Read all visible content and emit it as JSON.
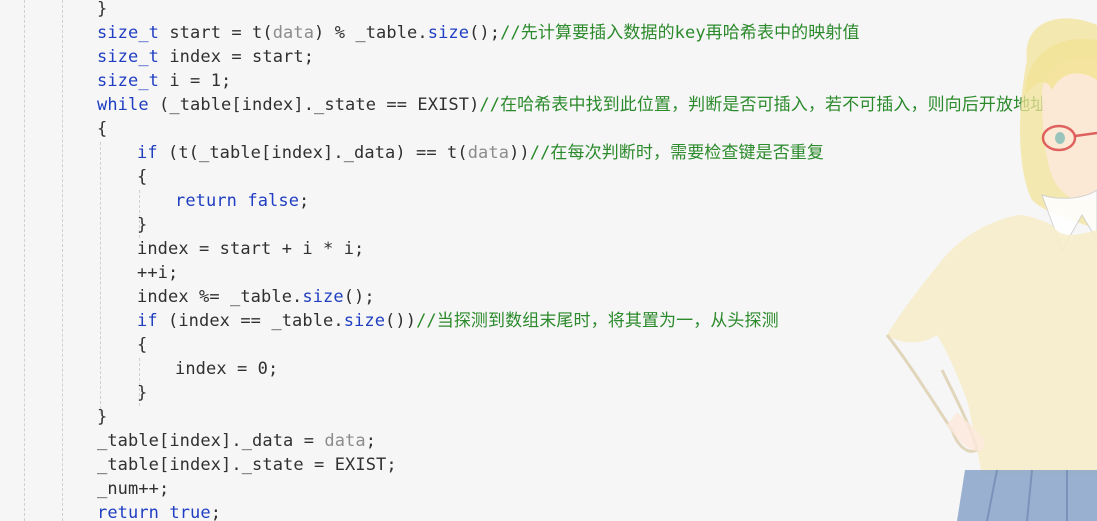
{
  "code": {
    "lines": [
      [
        {
          "t": "}",
          "c": "p"
        }
      ],
      [
        {
          "t": "size_t",
          "c": "k"
        },
        {
          "t": " start = t(",
          "c": "p"
        },
        {
          "t": "data",
          "c": "d"
        },
        {
          "t": ") % _table.",
          "c": "p"
        },
        {
          "t": "size",
          "c": "k"
        },
        {
          "t": "();",
          "c": "p"
        },
        {
          "t": "//先计算要插入数据的key再哈希表中的映射值",
          "c": "c"
        }
      ],
      [
        {
          "t": "size_t",
          "c": "k"
        },
        {
          "t": " index = start;",
          "c": "p"
        }
      ],
      [
        {
          "t": "size_t",
          "c": "k"
        },
        {
          "t": " i = 1;",
          "c": "p"
        }
      ],
      [
        {
          "t": "while",
          "c": "k"
        },
        {
          "t": " (_table[index]._state == EXIST)",
          "c": "p"
        },
        {
          "t": "//在哈希表中找到此位置，判断是否可插入，若不可插入，则向后开放地址",
          "c": "c"
        }
      ],
      [
        {
          "t": "{",
          "c": "p"
        }
      ],
      [
        {
          "t": "if",
          "c": "k"
        },
        {
          "t": " (t(_table[index]._data) == t(",
          "c": "p"
        },
        {
          "t": "data",
          "c": "d"
        },
        {
          "t": "))",
          "c": "p"
        },
        {
          "t": "//在每次判断时，需要检查键是否重复",
          "c": "c"
        }
      ],
      [
        {
          "t": "{",
          "c": "p"
        }
      ],
      [
        {
          "t": "return",
          "c": "k"
        },
        {
          "t": " ",
          "c": "p"
        },
        {
          "t": "false",
          "c": "k"
        },
        {
          "t": ";",
          "c": "p"
        }
      ],
      [
        {
          "t": "}",
          "c": "p"
        }
      ],
      [
        {
          "t": "index = start + i * i;",
          "c": "p"
        }
      ],
      [
        {
          "t": "++i;",
          "c": "p"
        }
      ],
      [
        {
          "t": "index %= _table.",
          "c": "p"
        },
        {
          "t": "size",
          "c": "k"
        },
        {
          "t": "();",
          "c": "p"
        }
      ],
      [
        {
          "t": "if",
          "c": "k"
        },
        {
          "t": " (index == _table.",
          "c": "p"
        },
        {
          "t": "size",
          "c": "k"
        },
        {
          "t": "())",
          "c": "p"
        },
        {
          "t": "//当探测到数组末尾时，将其置为一，从头探测",
          "c": "c"
        }
      ],
      [
        {
          "t": "{",
          "c": "p"
        }
      ],
      [
        {
          "t": "index = 0;",
          "c": "p"
        }
      ],
      [
        {
          "t": "}",
          "c": "p"
        }
      ],
      [
        {
          "t": "}",
          "c": "p"
        }
      ],
      [
        {
          "t": "_table[index]._data = ",
          "c": "p"
        },
        {
          "t": "data",
          "c": "d"
        },
        {
          "t": ";",
          "c": "p"
        }
      ],
      [
        {
          "t": "_table[index]._state = EXIST;",
          "c": "p"
        }
      ],
      [
        {
          "t": "_num++;",
          "c": "p"
        }
      ],
      [
        {
          "t": "return",
          "c": "k"
        },
        {
          "t": " ",
          "c": "p"
        },
        {
          "t": "true",
          "c": "k"
        },
        {
          "t": ";",
          "c": "p"
        }
      ]
    ]
  },
  "decoration": {
    "name": "anime-girl-illustration",
    "colors": {
      "hair": "#f3e39a",
      "skin": "#fde9dc",
      "sweater": "#f7ecc9",
      "skirt": "#8aa3c9",
      "glasses": "#d94a4a"
    }
  }
}
